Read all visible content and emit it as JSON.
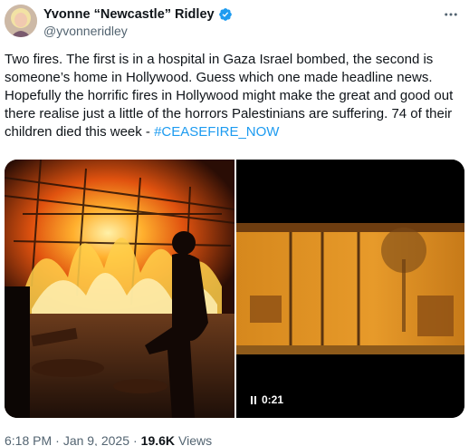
{
  "author": {
    "display_name": "Yvonne “Newcastle” Ridley",
    "handle": "@yvonneridley",
    "verified": true,
    "verified_color": "#1d9bf0",
    "avatar_icon": "profile-photo"
  },
  "menu": {
    "icon": "more-dots-icon"
  },
  "tweet": {
    "text": "Two fires. The first is in a hospital in Gaza Israel bombed, the second is someone’s home in Hollywood. Guess which one made headline news. Hopefully the horrific fires in Hollywood might make the great and good out there realise just a little of the horrors Palestinians are suffering. 74 of their children died this week - ",
    "hashtag": "#CEASEFIRE_NOW",
    "hashtag_color": "#1d9bf0"
  },
  "media": {
    "left": {
      "kind": "photo",
      "description_icon": "fire-photo"
    },
    "right": {
      "kind": "video",
      "duration": "0:21",
      "state_icon": "pause-icon"
    }
  },
  "meta": {
    "time": "6:18 PM",
    "date": "Jan 9, 2025",
    "views_count": "19.6K",
    "views_label": "Views",
    "separator": "·"
  }
}
